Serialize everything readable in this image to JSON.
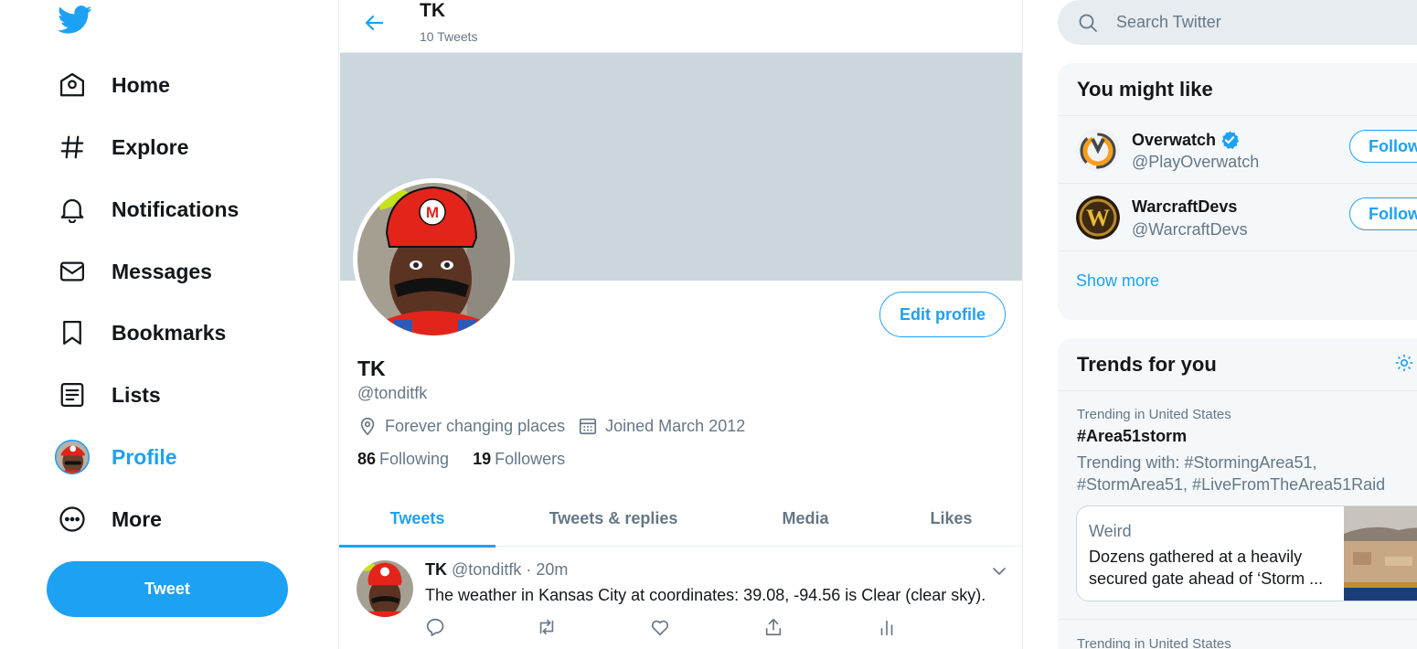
{
  "nav": {
    "items": [
      {
        "label": "Home",
        "icon": "home-icon"
      },
      {
        "label": "Explore",
        "icon": "hashtag-icon"
      },
      {
        "label": "Notifications",
        "icon": "bell-icon"
      },
      {
        "label": "Messages",
        "icon": "envelope-icon"
      },
      {
        "label": "Bookmarks",
        "icon": "bookmark-icon"
      },
      {
        "label": "Lists",
        "icon": "list-icon"
      },
      {
        "label": "Profile",
        "icon": "profile-avatar"
      },
      {
        "label": "More",
        "icon": "more-dots-icon"
      }
    ],
    "tweet_button": "Tweet"
  },
  "header": {
    "title": "TK",
    "subtitle": "10 Tweets"
  },
  "profile": {
    "name": "TK",
    "handle": "@tonditfk",
    "location": "Forever changing places",
    "joined": "Joined March 2012",
    "following_count": "86",
    "following_label": "Following",
    "followers_count": "19",
    "followers_label": "Followers",
    "edit_button": "Edit profile"
  },
  "tabs": [
    {
      "label": "Tweets"
    },
    {
      "label": "Tweets & replies"
    },
    {
      "label": "Media"
    },
    {
      "label": "Likes"
    }
  ],
  "tweet": {
    "name": "TK",
    "handle": "@tonditfk",
    "separator": "·",
    "time": "20m",
    "text": "The weather in Kansas City at coordinates: 39.08, -94.56 is Clear (clear sky)."
  },
  "search": {
    "placeholder": "Search Twitter"
  },
  "who_to_follow": {
    "title": "You might like",
    "accounts": [
      {
        "name": "Overwatch",
        "handle": "@PlayOverwatch",
        "verified": true,
        "button": "Follow"
      },
      {
        "name": "WarcraftDevs",
        "handle": "@WarcraftDevs",
        "verified": false,
        "button": "Follow"
      }
    ],
    "show_more": "Show more"
  },
  "trends": {
    "title": "Trends for you",
    "items": [
      {
        "context": "Trending in United States",
        "tag": "#Area51storm",
        "with": "Trending with: #StormingArea51, #StormArea51, #LiveFromTheArea51Raid",
        "card_category": "Weird",
        "card_text": "Dozens gathered at a heavily secured gate ahead of ‘Storm ..."
      },
      {
        "context": "Trending in United States"
      }
    ]
  },
  "colors": {
    "accent": "#1da1f2",
    "banner": "#ccd6dd",
    "text_primary": "#14171a",
    "text_secondary": "#657786",
    "panel_bg": "#f5f8fa",
    "border": "#e6ecf0"
  }
}
